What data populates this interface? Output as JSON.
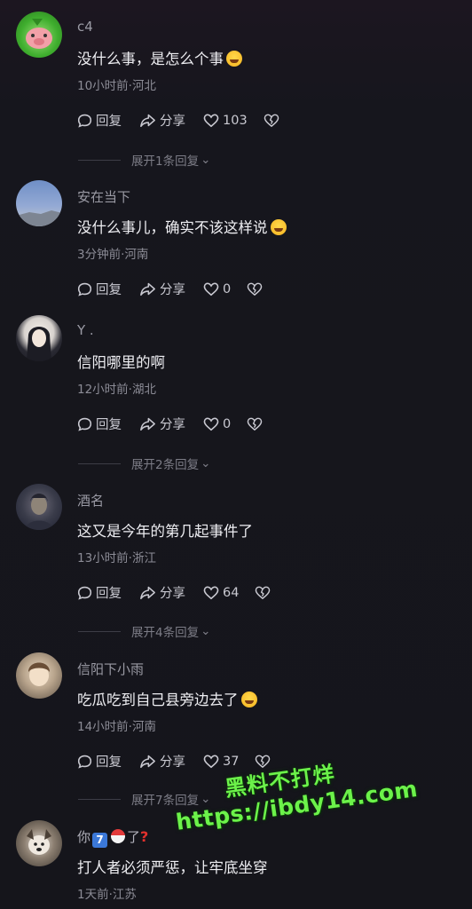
{
  "comments": [
    {
      "user": "c4",
      "text": "没什么事，是怎么个事",
      "emoji": "rofl-emoji",
      "meta": "10小时前·河北",
      "reply": "回复",
      "share": "分享",
      "likes": "103",
      "expand": "展开1条回复"
    },
    {
      "user": "安在当下",
      "text": "没什么事儿，确实不该这样说",
      "emoji": "rofl-emoji",
      "meta": "3分钟前·河南",
      "reply": "回复",
      "share": "分享",
      "likes": "0"
    },
    {
      "user": "Y .",
      "text": "信阳哪里的啊",
      "meta": "12小时前·湖北",
      "reply": "回复",
      "share": "分享",
      "likes": "0",
      "expand": "展开2条回复"
    },
    {
      "user": "酒名",
      "text": "这又是今年的第几起事件了",
      "meta": "13小时前·浙江",
      "reply": "回复",
      "share": "分享",
      "likes": "64",
      "expand": "展开4条回复"
    },
    {
      "user": "信阳下小雨",
      "text": "吃瓜吃到自己县旁边去了",
      "emoji": "rofl-emoji",
      "meta": "14小时前·河南",
      "reply": "回复",
      "share": "分享",
      "likes": "37",
      "expand": "展开7条回复"
    },
    {
      "user_prefix": "你",
      "user_suffix": "了",
      "user_icons": [
        "keycap-7-icon",
        "ball-icon",
        "question-mark-icon"
      ],
      "text": "打人者必须严惩，让牢底坐穿",
      "meta": "1天前·江苏"
    }
  ],
  "watermark": {
    "line1": "黑料不打烊",
    "line2": "https://ibdy14.com"
  },
  "colors": {
    "background": "#15151b",
    "text": "#eeeef2",
    "muted": "#8c8c96",
    "watermark": "#6cf24a"
  }
}
